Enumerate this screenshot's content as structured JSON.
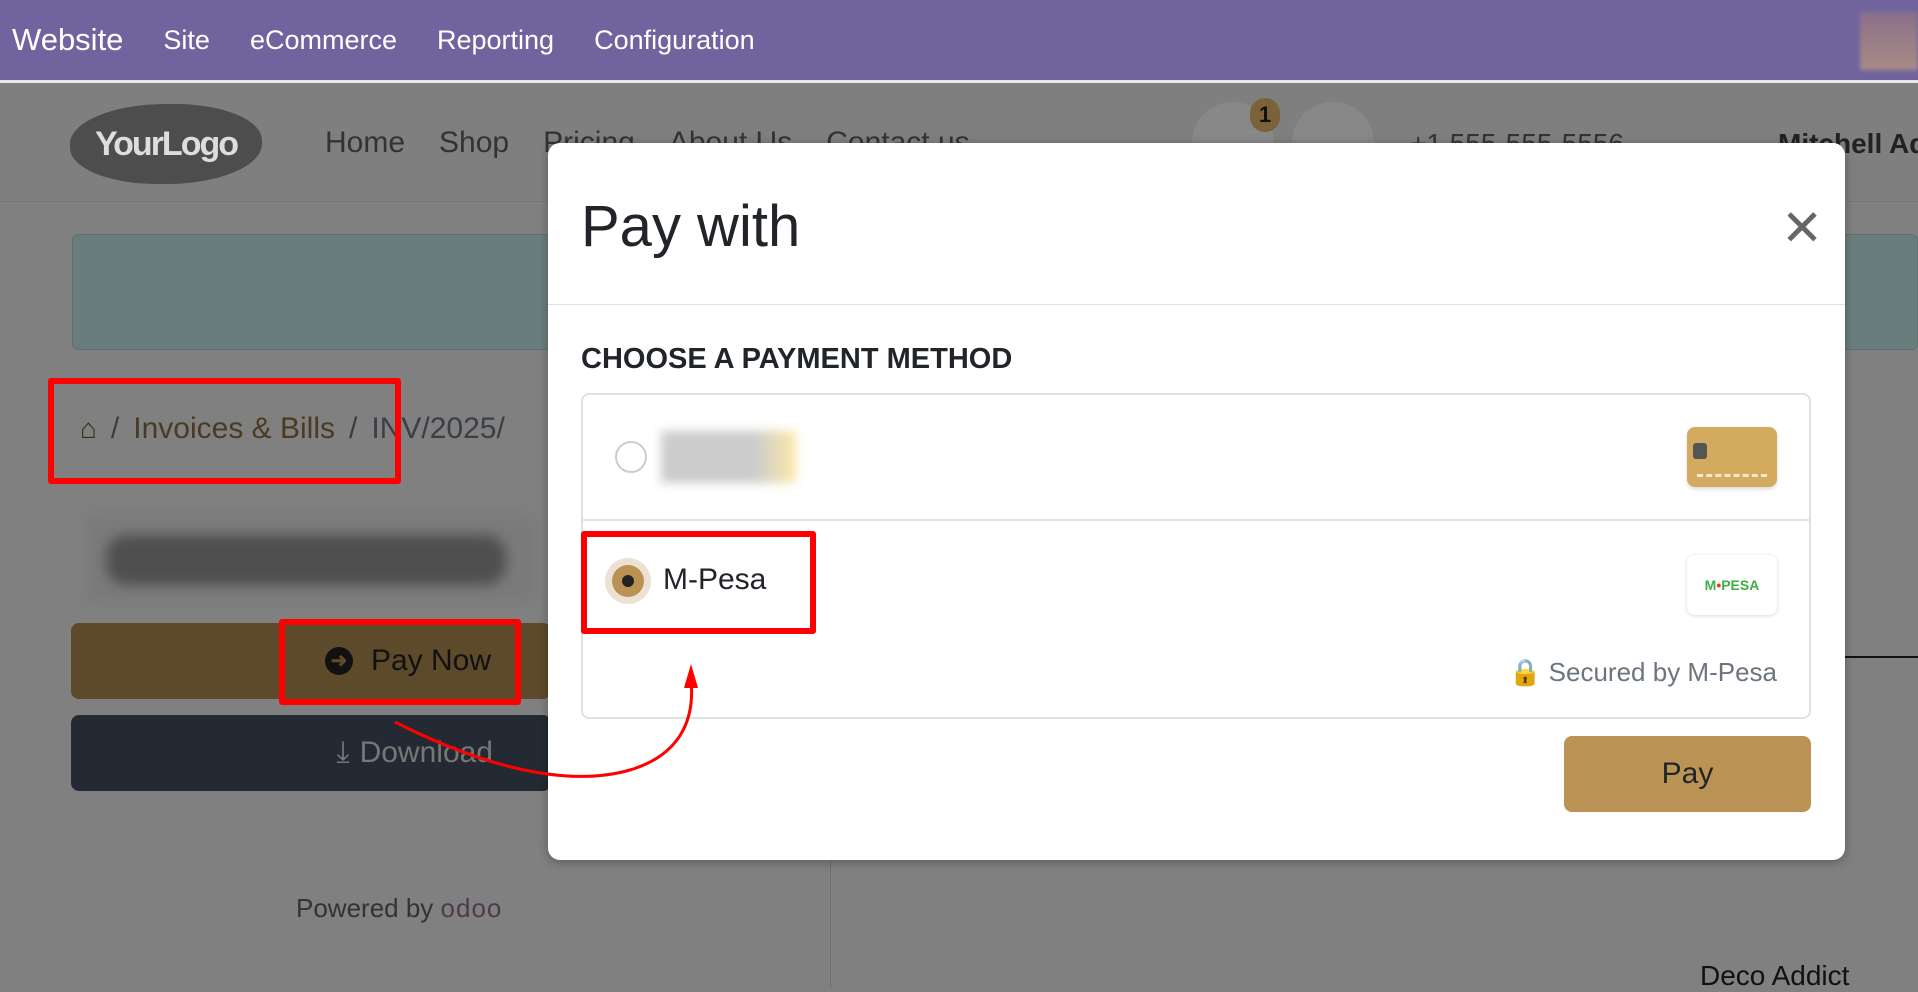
{
  "topbar": {
    "brand": "Website",
    "menu": [
      "Site",
      "eCommerce",
      "Reporting",
      "Configuration"
    ]
  },
  "header": {
    "logo": "YourLogo",
    "nav": [
      "Home",
      "Shop",
      "Pricing",
      "About Us",
      "Contact us"
    ],
    "cart_count": "1",
    "phone": "+1 555-555-5556",
    "user": "Mitchell Admin"
  },
  "breadcrumb": {
    "sep": "/",
    "invoices": "Invoices & Bills",
    "current": "INV/2025/"
  },
  "left": {
    "pay_now": "Pay Now",
    "download": "Download",
    "powered_by": "Powered by",
    "odoo": "odoo"
  },
  "right": {
    "customer": "Deco Addict"
  },
  "modal": {
    "title": "Pay with",
    "heading": "CHOOSE A PAYMENT METHOD",
    "methods": [
      {
        "label": "",
        "selected": false,
        "icon": "credit-card-icon"
      },
      {
        "label": "M-Pesa",
        "selected": true,
        "logo": "M-PESA"
      }
    ],
    "secured": "Secured by M-Pesa",
    "pay": "Pay"
  },
  "colors": {
    "topbar": "#71639e",
    "accent": "#bb9455",
    "annotation": "#ff0000"
  }
}
